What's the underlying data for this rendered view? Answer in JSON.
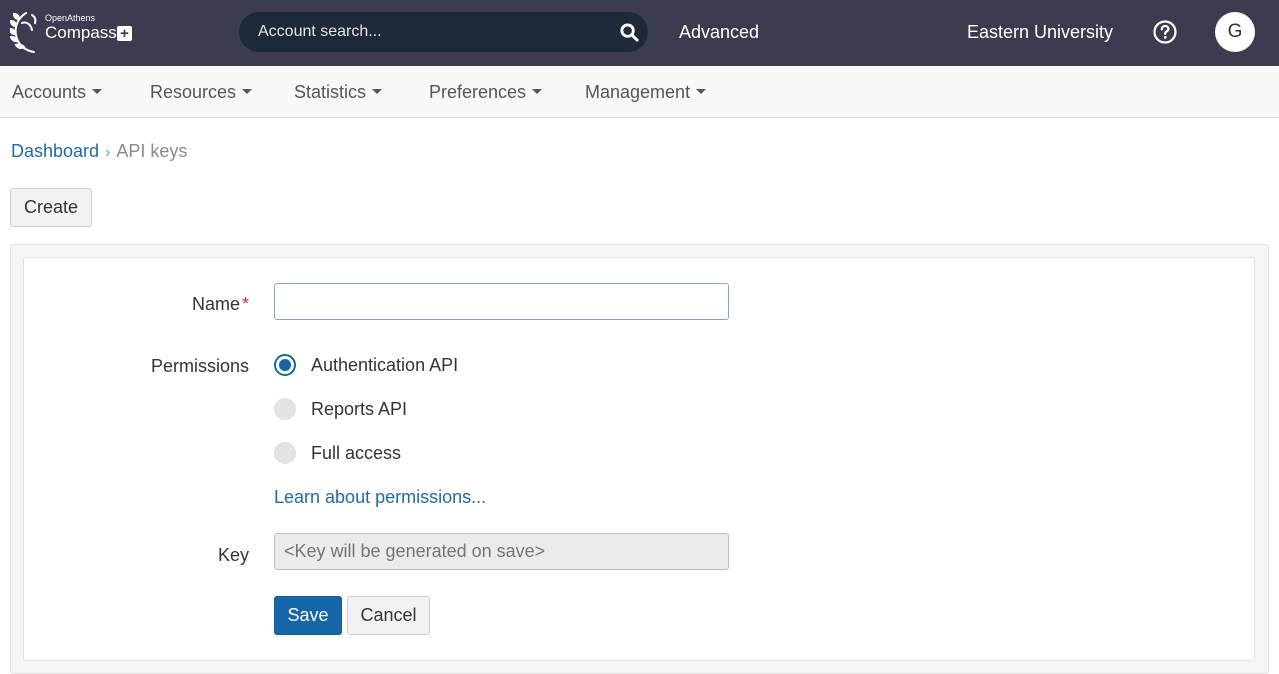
{
  "header": {
    "logo_small": "OpenAthens",
    "logo_big": "Compass",
    "logo_plus": "+",
    "search_placeholder": "Account search...",
    "advanced_label": "Advanced",
    "org_name": "Eastern University",
    "avatar_initial": "G",
    "background_color": "#3b3c4f"
  },
  "nav": {
    "items": [
      "Accounts",
      "Resources",
      "Statistics",
      "Preferences",
      "Management"
    ]
  },
  "breadcrumb": {
    "items": [
      "Dashboard",
      "API keys"
    ]
  },
  "toolbar": {
    "create_label": "Create"
  },
  "form": {
    "name_label": "Name",
    "required_mark": "*",
    "name_value": "",
    "permissions_label": "Permissions",
    "permission_options": [
      {
        "label": "Authentication API",
        "selected": true
      },
      {
        "label": "Reports API",
        "selected": false
      },
      {
        "label": "Full access",
        "selected": false
      }
    ],
    "learn_link": "Learn about permissions...",
    "key_label": "Key",
    "key_placeholder": "<Key will be generated on save>",
    "save_label": "Save",
    "cancel_label": "Cancel",
    "accent_color": "#1566a8"
  }
}
